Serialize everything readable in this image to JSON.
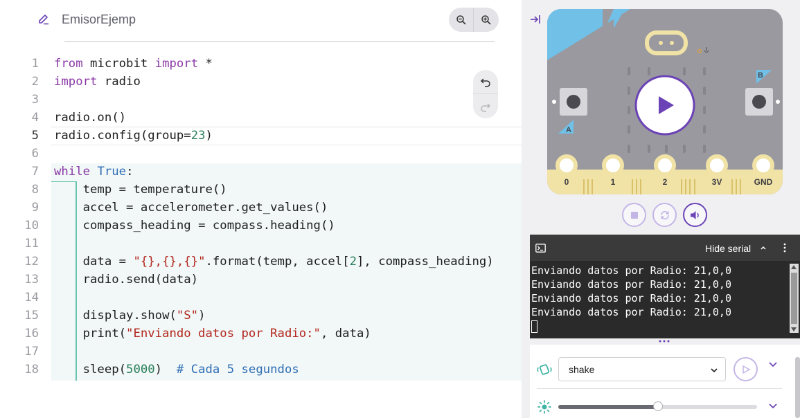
{
  "project": {
    "name": "EmisorEjemp",
    "zoom_out": "zoom out",
    "zoom_in": "zoom in"
  },
  "editor": {
    "lines": [
      {
        "n": "1",
        "t": [
          {
            "c": "kw",
            "s": "from"
          },
          {
            "c": "",
            "s": " microbit "
          },
          {
            "c": "kw",
            "s": "import"
          },
          {
            "c": "",
            "s": " *"
          }
        ]
      },
      {
        "n": "2",
        "t": [
          {
            "c": "kw",
            "s": "import"
          },
          {
            "c": "",
            "s": " radio"
          }
        ]
      },
      {
        "n": "3",
        "t": []
      },
      {
        "n": "4",
        "t": [
          {
            "c": "",
            "s": "radio.on()"
          }
        ]
      },
      {
        "n": "5",
        "t": [
          {
            "c": "",
            "s": "radio.config(group="
          },
          {
            "c": "num",
            "s": "23"
          },
          {
            "c": "",
            "s": ")"
          }
        ]
      },
      {
        "n": "6",
        "t": []
      },
      {
        "n": "7",
        "t": [
          {
            "c": "kw",
            "s": "while"
          },
          {
            "c": "",
            "s": " "
          },
          {
            "c": "kb",
            "s": "True"
          },
          {
            "c": "",
            "s": ":"
          }
        ]
      },
      {
        "n": "8",
        "t": [
          {
            "c": "",
            "s": "    temp = temperature()"
          }
        ]
      },
      {
        "n": "9",
        "t": [
          {
            "c": "",
            "s": "    accel = accelerometer.get_values()"
          }
        ]
      },
      {
        "n": "10",
        "t": [
          {
            "c": "",
            "s": "    compass_heading = compass.heading()"
          }
        ]
      },
      {
        "n": "11",
        "t": []
      },
      {
        "n": "12",
        "t": [
          {
            "c": "",
            "s": "    data = "
          },
          {
            "c": "str",
            "s": "\"{},{},{}\""
          },
          {
            "c": "",
            "s": ".format(temp, accel["
          },
          {
            "c": "num",
            "s": "2"
          },
          {
            "c": "",
            "s": "], compass_heading)"
          }
        ]
      },
      {
        "n": "13",
        "t": [
          {
            "c": "",
            "s": "    radio.send(data)"
          }
        ]
      },
      {
        "n": "14",
        "t": []
      },
      {
        "n": "15",
        "t": [
          {
            "c": "",
            "s": "    display.show("
          },
          {
            "c": "str",
            "s": "\"S\""
          },
          {
            "c": "",
            "s": ")"
          }
        ]
      },
      {
        "n": "16",
        "t": [
          {
            "c": "",
            "s": "    print("
          },
          {
            "c": "str",
            "s": "\"Enviando datos por Radio:\""
          },
          {
            "c": "",
            "s": ", data)"
          }
        ]
      },
      {
        "n": "17",
        "t": []
      },
      {
        "n": "18",
        "t": [
          {
            "c": "",
            "s": "    sleep("
          },
          {
            "c": "num",
            "s": "5000"
          },
          {
            "c": "",
            "s": ")  "
          },
          {
            "c": "cmt",
            "s": "# Cada 5 segundos"
          }
        ]
      }
    ],
    "current_line": "5"
  },
  "simulator": {
    "pins": [
      "0",
      "1",
      "2",
      "3V",
      "GND"
    ],
    "button_a": "A",
    "button_b": "B"
  },
  "serial": {
    "hide_label": "Hide serial",
    "output": [
      "Enviando datos por Radio: 21,0,0",
      "Enviando datos por Radio: 21,0,0",
      "Enviando datos por Radio: 21,0,0",
      "Enviando datos por Radio: 21,0,0"
    ]
  },
  "sensors": {
    "gesture": "shake",
    "light_level": 0.5
  },
  "icons": {
    "edit": "pencil-icon",
    "zoom_out": "zoom-out-icon",
    "zoom_in": "zoom-in-icon",
    "undo": "undo-icon",
    "redo": "redo-icon",
    "collapse": "collapse-right-icon",
    "play": "play-icon",
    "stop": "stop-icon",
    "reset": "reset-icon",
    "sound": "sound-icon",
    "terminal": "terminal-icon",
    "gesture": "gesture-icon",
    "light": "sun-icon"
  },
  "colors": {
    "accent": "#6b43b6",
    "board": "#99999f",
    "board_blue": "#70c0e8",
    "pins": "#f1e2a6",
    "serial_bg": "#2a2a2a",
    "block_line": "#6cc2b0"
  }
}
